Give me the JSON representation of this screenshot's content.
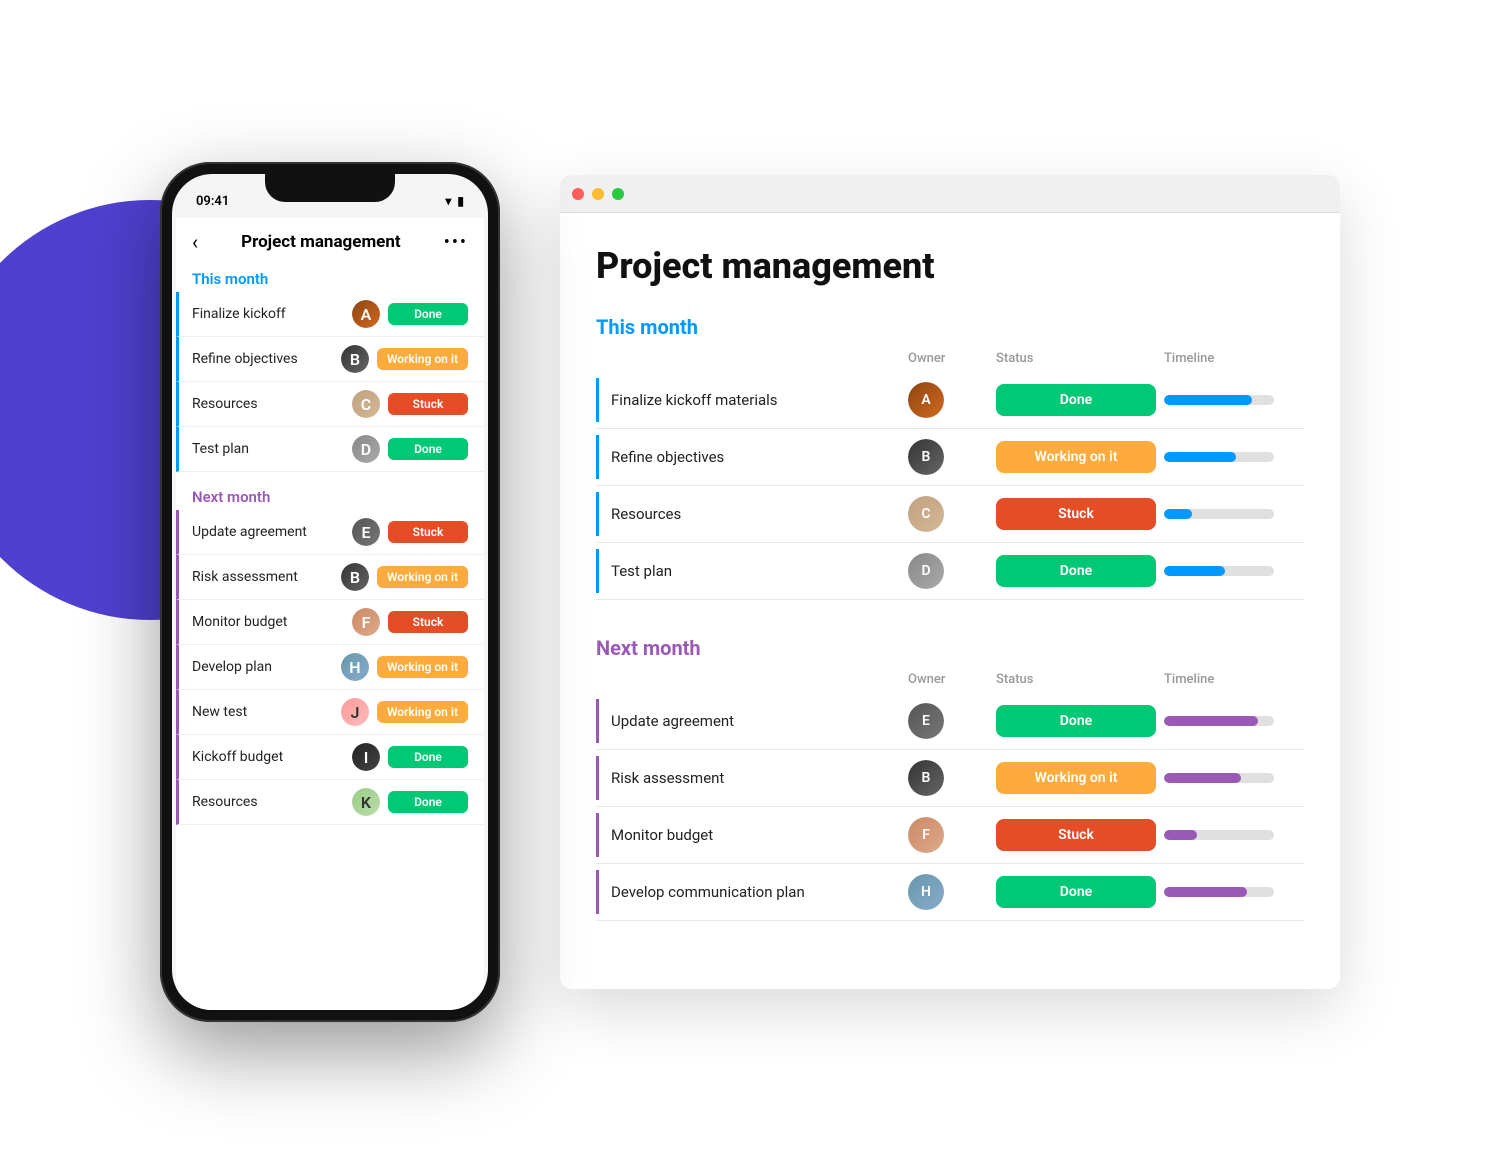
{
  "app": {
    "title": "Project management"
  },
  "phone": {
    "time": "09:41",
    "title": "Project management",
    "back_label": "‹",
    "more_label": "•••",
    "this_month_label": "This month",
    "next_month_label": "Next month",
    "this_month_items": [
      {
        "name": "Finalize kickoff",
        "status": "Done",
        "status_type": "done",
        "avatar_class": "avatar-1",
        "avatar_label": "A"
      },
      {
        "name": "Refine objectives",
        "status": "Working on it",
        "status_type": "working",
        "avatar_class": "avatar-2",
        "avatar_label": "B"
      },
      {
        "name": "Resources",
        "status": "Stuck",
        "status_type": "stuck",
        "avatar_class": "avatar-3",
        "avatar_label": "C"
      },
      {
        "name": "Test plan",
        "status": "Done",
        "status_type": "done",
        "avatar_class": "avatar-4",
        "avatar_label": "D"
      }
    ],
    "next_month_items": [
      {
        "name": "Update agreement",
        "status": "Stuck",
        "status_type": "stuck",
        "avatar_class": "avatar-5",
        "avatar_label": "E"
      },
      {
        "name": "Risk assessment",
        "status": "Working on it",
        "status_type": "working",
        "avatar_class": "avatar-2",
        "avatar_label": "B"
      },
      {
        "name": "Monitor budget",
        "status": "Stuck",
        "status_type": "stuck",
        "avatar_class": "avatar-6",
        "avatar_label": "F"
      },
      {
        "name": "Develop plan",
        "status": "Working on it",
        "status_type": "working",
        "avatar_class": "avatar-8",
        "avatar_label": "H"
      },
      {
        "name": "New test",
        "status": "Working on it",
        "status_type": "working",
        "avatar_class": "avatar-10",
        "avatar_label": "J"
      },
      {
        "name": "Kickoff budget",
        "status": "Done",
        "status_type": "done",
        "avatar_class": "avatar-9",
        "avatar_label": "I"
      },
      {
        "name": "Resources",
        "status": "Done",
        "status_type": "done",
        "avatar_class": "avatar-11",
        "avatar_label": "K"
      }
    ]
  },
  "desktop": {
    "title": "Project management",
    "owner_label": "Owner",
    "status_label": "Status",
    "timeline_label": "Timeline",
    "this_month_label": "This month",
    "next_month_label": "Next month",
    "this_month_items": [
      {
        "name": "Finalize kickoff materials",
        "status": "Done",
        "status_type": "done",
        "avatar_class": "avatar-1",
        "avatar_label": "A",
        "timeline_width": 80,
        "timeline_color": "timeline-blue"
      },
      {
        "name": "Refine objectives",
        "status": "Working on it",
        "status_type": "working",
        "avatar_class": "avatar-2",
        "avatar_label": "B",
        "timeline_width": 65,
        "timeline_color": "timeline-blue"
      },
      {
        "name": "Resources",
        "status": "Stuck",
        "status_type": "stuck",
        "avatar_class": "avatar-3",
        "avatar_label": "C",
        "timeline_width": 25,
        "timeline_color": "timeline-blue"
      },
      {
        "name": "Test plan",
        "status": "Done",
        "status_type": "done",
        "avatar_class": "avatar-4",
        "avatar_label": "D",
        "timeline_width": 55,
        "timeline_color": "timeline-blue"
      }
    ],
    "next_month_items": [
      {
        "name": "Update agreement",
        "status": "Done",
        "status_type": "done",
        "avatar_class": "avatar-5",
        "avatar_label": "E",
        "timeline_width": 85,
        "timeline_color": "timeline-purple"
      },
      {
        "name": "Risk assessment",
        "status": "Working on it",
        "status_type": "working",
        "avatar_class": "avatar-2",
        "avatar_label": "B",
        "timeline_width": 70,
        "timeline_color": "timeline-purple"
      },
      {
        "name": "Monitor budget",
        "status": "Stuck",
        "status_type": "stuck",
        "avatar_class": "avatar-6",
        "avatar_label": "F",
        "timeline_width": 30,
        "timeline_color": "timeline-purple"
      },
      {
        "name": "Develop communication plan",
        "status": "Done",
        "status_type": "done",
        "avatar_class": "avatar-8",
        "avatar_label": "H",
        "timeline_width": 75,
        "timeline_color": "timeline-purple"
      }
    ]
  },
  "colors": {
    "done": "#00c875",
    "working": "#fdab3d",
    "stuck": "#e44d26",
    "blue_accent": "#0099ff",
    "purple_accent": "#9b59b6"
  }
}
